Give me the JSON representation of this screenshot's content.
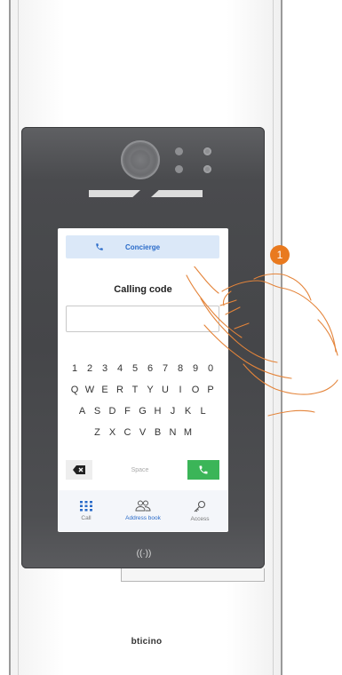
{
  "screen": {
    "concierge_label": "Concierge",
    "calling_code_title": "Calling code",
    "calling_code_value": "",
    "keyboard": {
      "row1": [
        "1",
        "2",
        "3",
        "4",
        "5",
        "6",
        "7",
        "8",
        "9",
        "0"
      ],
      "row2": [
        "Q",
        "W",
        "E",
        "R",
        "T",
        "Y",
        "U",
        "I",
        "O",
        "P"
      ],
      "row3": [
        "A",
        "S",
        "D",
        "F",
        "G",
        "H",
        "J",
        "K",
        "L"
      ],
      "row4": [
        "Z",
        "X",
        "C",
        "V",
        "B",
        "N",
        "M"
      ],
      "space_label": "Space"
    },
    "nav": [
      {
        "label": "Call",
        "icon": "keypad-icon",
        "active": false
      },
      {
        "label": "Address book",
        "icon": "people-icon",
        "active": true
      },
      {
        "label": "Access",
        "icon": "key-icon",
        "active": false
      }
    ]
  },
  "device": {
    "nfc_symbol": "((·))",
    "brand": "bticino"
  },
  "annotation": {
    "step_number": "1"
  },
  "colors": {
    "accent_blue": "#2a6bc9",
    "call_green": "#3bb558",
    "callout_orange": "#e97a1f"
  }
}
